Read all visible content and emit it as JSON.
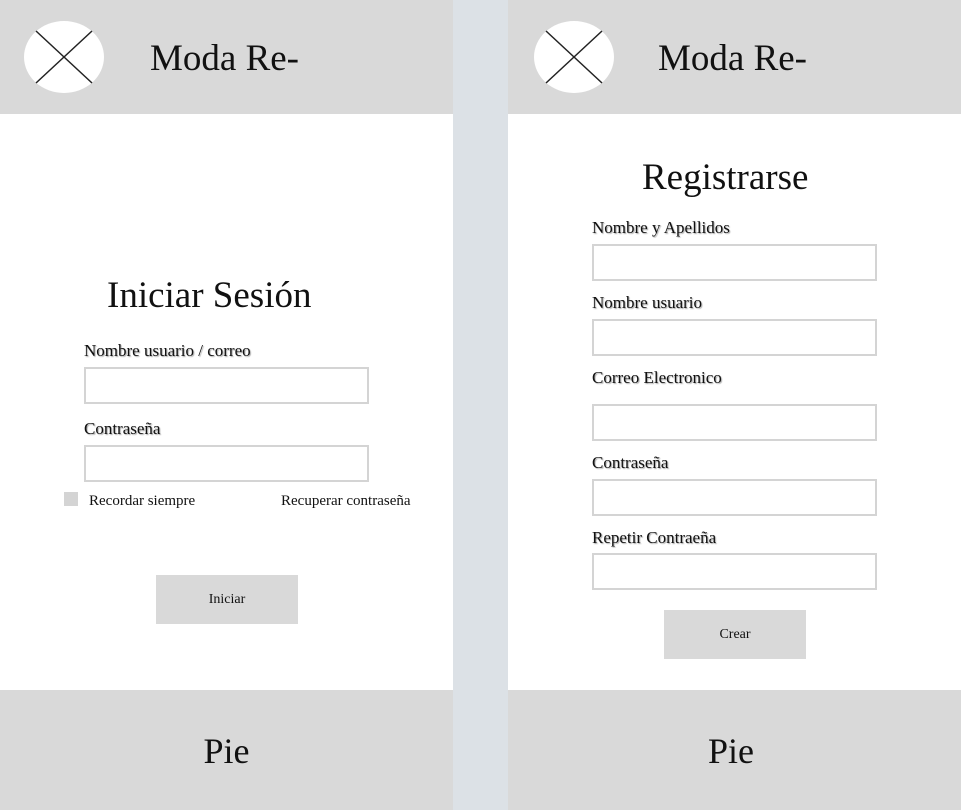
{
  "login": {
    "header": {
      "brand": "Moda Re-",
      "logo_icon": "image-placeholder-icon"
    },
    "title": "Iniciar Sesión",
    "username_label": "Nombre usuario / correo",
    "username_value": "",
    "password_label": "Contraseña",
    "password_value": "",
    "remember_label": "Recordar siempre",
    "remember_checked": false,
    "recover_link": "Recuperar contraseña",
    "submit_label": "Iniciar",
    "footer": "Pie"
  },
  "register": {
    "header": {
      "brand": "Moda Re-",
      "logo_icon": "image-placeholder-icon"
    },
    "title": "Registrarse",
    "fullname_label": "Nombre y Apellidos",
    "fullname_value": "",
    "username_label": "Nombre usuario",
    "username_value": "",
    "email_label": "Correo Electronico",
    "email_value": "",
    "password_label": "Contraseña",
    "password_value": "",
    "repeat_password_label": "Repetir Contraeña",
    "repeat_password_value": "",
    "submit_label": "Crear",
    "footer": "Pie"
  },
  "colors": {
    "background": "#dce1e6",
    "panel": "#ffffff",
    "header_footer": "#d9d9d9",
    "field_border": "#d4d4d4",
    "button": "#d9d9d9"
  }
}
